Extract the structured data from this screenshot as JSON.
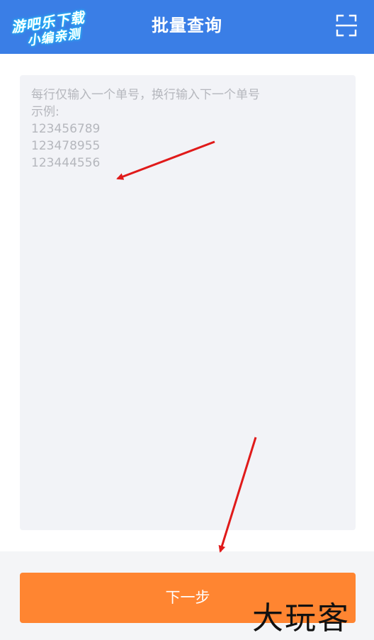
{
  "header": {
    "title": "批量查询",
    "watermark_line1": "游吧乐下载",
    "watermark_line2": "小编亲测",
    "scan_icon": "scan-icon"
  },
  "input": {
    "placeholder_lines": [
      "每行仅输入一个单号，换行输入下一个单号",
      "示例:",
      "123456789",
      "123478955",
      "123444556"
    ]
  },
  "footer": {
    "next_label": "下一步"
  },
  "corner_watermark": "大玩客",
  "colors": {
    "header_bg": "#3a7ee6",
    "button_bg": "#ff8531",
    "annotation_arrow": "#e01a1a"
  }
}
